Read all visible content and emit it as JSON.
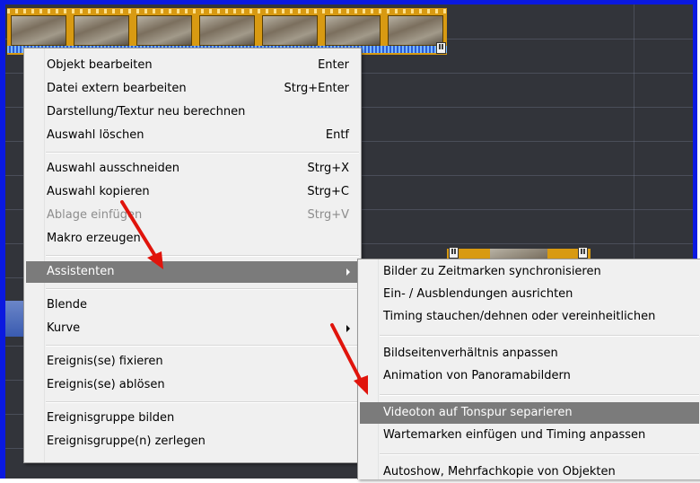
{
  "colors": {
    "frame_blue": "#0a19e0",
    "timeline_bg": "#32343a",
    "clip_orange": "#d89a12",
    "menu_bg": "#f0f0f0",
    "highlight": "#7b7b7b",
    "arrow_red": "#e0140c"
  },
  "main_menu": {
    "groups": [
      [
        {
          "label": "Objekt bearbeiten",
          "shortcut": "Enter"
        },
        {
          "label": "Datei extern bearbeiten",
          "shortcut": "Strg+Enter"
        },
        {
          "label": "Darstellung/Textur neu berechnen",
          "shortcut": ""
        },
        {
          "label": "Auswahl löschen",
          "shortcut": "Entf"
        }
      ],
      [
        {
          "label": "Auswahl ausschneiden",
          "shortcut": "Strg+X"
        },
        {
          "label": "Auswahl kopieren",
          "shortcut": "Strg+C"
        },
        {
          "label": "Ablage einfügen",
          "shortcut": "Strg+V",
          "disabled": true
        },
        {
          "label": "Makro erzeugen",
          "shortcut": ""
        }
      ],
      [
        {
          "label": "Assistenten",
          "submenu": true,
          "highlighted": true
        }
      ],
      [
        {
          "label": "Blende",
          "shortcut": ""
        },
        {
          "label": "Kurve",
          "submenu": true
        }
      ],
      [
        {
          "label": "Ereignis(se) fixieren",
          "shortcut": ""
        },
        {
          "label": "Ereignis(se) ablösen",
          "shortcut": ""
        }
      ],
      [
        {
          "label": "Ereignisgruppe bilden",
          "shortcut": ""
        },
        {
          "label": "Ereignisgruppe(n) zerlegen",
          "shortcut": ""
        }
      ]
    ]
  },
  "sub_menu": {
    "groups": [
      [
        {
          "label": "Bilder zu Zeitmarken synchronisieren"
        },
        {
          "label": "Ein- / Ausblendungen ausrichten"
        },
        {
          "label": "Timing stauchen/dehnen oder vereinheitlichen"
        }
      ],
      [
        {
          "label": "Bildseitenverhältnis anpassen"
        },
        {
          "label": "Animation von Panoramabildern"
        }
      ],
      [
        {
          "label": "Videoton auf Tonspur separieren",
          "highlighted": true
        },
        {
          "label": "Wartemarken einfügen und Timing anpassen"
        }
      ],
      [
        {
          "label": "Autoshow, Mehrfachkopie von Objekten"
        }
      ]
    ]
  },
  "handle_icon_glyph": "II"
}
